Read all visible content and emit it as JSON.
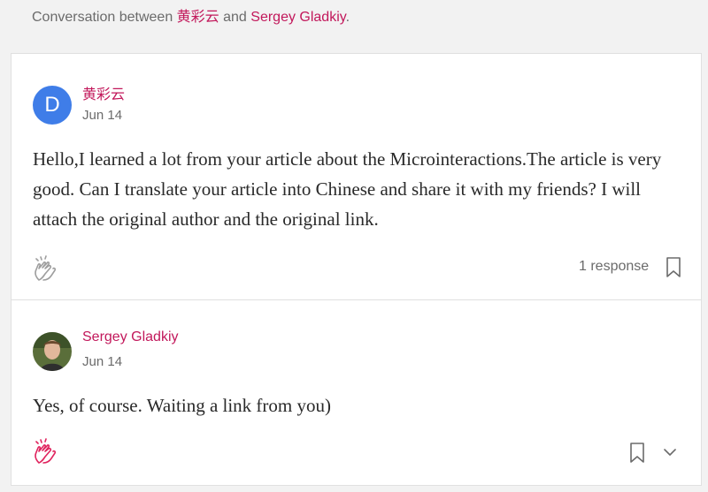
{
  "header": {
    "prefix": "Conversation between ",
    "user1": "黄彩云",
    "conjunction": " and ",
    "user2": "Sergey Gladkiy",
    "suffix": "."
  },
  "post1": {
    "avatar_letter": "D",
    "author": "黄彩云",
    "date": "Jun 14",
    "text": "Hello,I learned a lot from your article about the Microinteractions.The article is very good. Can I translate your article into Chinese and share it with my friends? I will attach the original author and the original link.",
    "responses": "1 response",
    "clap_icon": "clap-icon",
    "bookmark_icon": "bookmark-icon"
  },
  "post2": {
    "author": "Sergey Gladkiy",
    "date": "Jun 14",
    "text": "Yes, of course. Waiting a link from you)",
    "clap_icon": "clap-icon",
    "bookmark_icon": "bookmark-icon",
    "more_icon": "chevron-down-icon"
  },
  "colors": {
    "accent": "#c2185b",
    "avatar_bg": "#3f7de8",
    "muted": "#6b6b6b"
  }
}
